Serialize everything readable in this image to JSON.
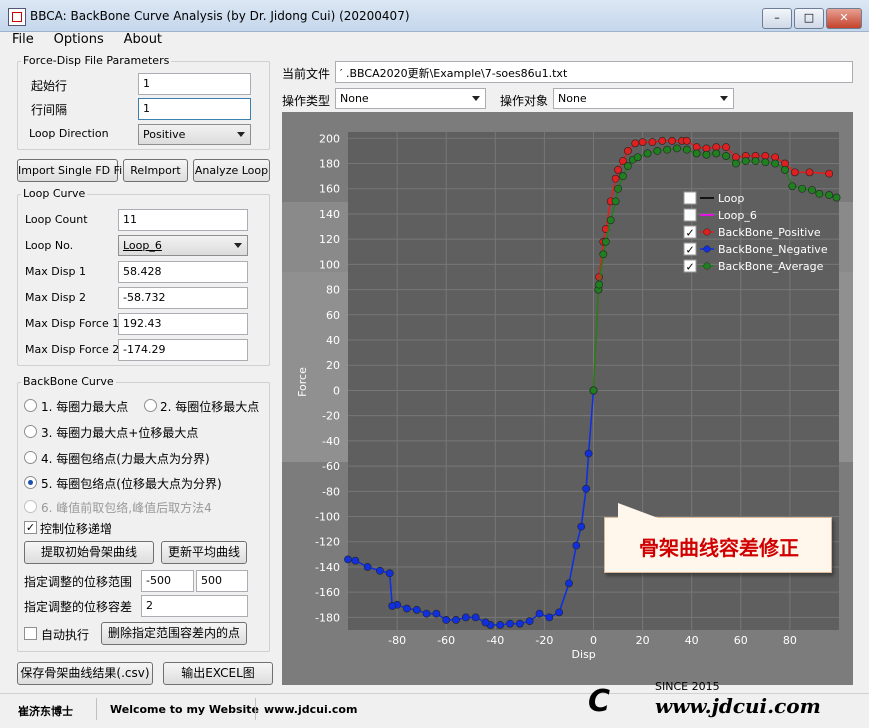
{
  "window": {
    "title": "BBCA: BackBone Curve Analysis (by Dr. Jidong Cui) (20200407)",
    "min": "–",
    "max": "□",
    "close": "✕"
  },
  "menu": [
    "File",
    "Options",
    "About"
  ],
  "fd_params": {
    "title": "Force-Disp File Parameters",
    "start_row_label": "起始行",
    "start_row": "1",
    "row_interval_label": "行间隔",
    "row_interval": "1",
    "loop_dir_label": "Loop Direction",
    "loop_dir": "Positive"
  },
  "buttons": {
    "import": "Import Single FD File",
    "reimport": "ReImport",
    "analyze": "Analyze Loop",
    "extract": "提取初始骨架曲线",
    "update": "更新平均曲线",
    "delete": "删除指定范围容差内的点",
    "save": "保存骨架曲线结果(.csv)",
    "excel": "输出EXCEL图"
  },
  "loop_curve": {
    "title": "Loop Curve",
    "count_label": "Loop Count",
    "count": "11",
    "no_label": "Loop No.",
    "no": "Loop_6",
    "max1_label": "Max Disp 1",
    "max1": "58.428",
    "max2_label": "Max Disp 2",
    "max2": "-58.732",
    "f1_label": "Max Disp Force 1",
    "f1": "192.43",
    "f2_label": "Max Disp Force 2",
    "f2": "-174.29"
  },
  "backbone": {
    "title": "BackBone Curve",
    "opt1": "1. 每圈力最大点",
    "opt2": "2. 每圈位移最大点",
    "opt3": "3. 每圈力最大点+位移最大点",
    "opt4": "4. 每圈包络点(力最大点为分界)",
    "opt5": "5. 每圈包络点(位移最大点为分界)",
    "opt6": "6. 峰值前取包络,峰值后取方法4",
    "ctrl": "控制位移递增",
    "range_label": "指定调整的位移范围",
    "range_min": "-500",
    "range_max": "500",
    "tol_label": "指定调整的位移容差",
    "tol": "2",
    "auto": "自动执行"
  },
  "file": {
    "label": "当前文件",
    "path": "′                                       .BBCA2020更新\\Example\\7-soes86u1.txt",
    "op_type_label": "操作类型",
    "op_type": "None",
    "op_target_label": "操作对象",
    "op_target": "None"
  },
  "status": {
    "author": "崔济东博士",
    "welcome": "Welcome to my Website",
    "site": "www.jdcui.com",
    "since": "SINCE 2015",
    "logo_text": "www.jdcui.com"
  },
  "callout": "骨架曲线容差修正",
  "chart_data": {
    "type": "line",
    "xlabel": "Disp",
    "ylabel": "Force",
    "xlim": [
      -100,
      100
    ],
    "ylim": [
      -190,
      205
    ],
    "xticks": [
      -80,
      -60,
      -40,
      -20,
      0,
      20,
      40,
      60,
      80
    ],
    "yticks": [
      200,
      180,
      160,
      140,
      120,
      100,
      80,
      60,
      40,
      20,
      0,
      -20,
      -40,
      -60,
      -80,
      -100,
      -120,
      -140,
      -160,
      -180
    ],
    "legend_position": "top-right",
    "series": [
      {
        "name": "Loop",
        "color": "#000000",
        "checked": false,
        "points": []
      },
      {
        "name": "Loop_6",
        "color": "#ff00ff",
        "checked": false,
        "points": []
      },
      {
        "name": "BackBone_Positive",
        "color": "#e02020",
        "checked": true,
        "points": [
          [
            0,
            0
          ],
          [
            2,
            80
          ],
          [
            2.3,
            90
          ],
          [
            4,
            118
          ],
          [
            5,
            128
          ],
          [
            7,
            150
          ],
          [
            9,
            168
          ],
          [
            10,
            175
          ],
          [
            12,
            182
          ],
          [
            14,
            190
          ],
          [
            17,
            196
          ],
          [
            20,
            197
          ],
          [
            24,
            197
          ],
          [
            28,
            198
          ],
          [
            32,
            198
          ],
          [
            36,
            198
          ],
          [
            38,
            198
          ],
          [
            42,
            193
          ],
          [
            46,
            192
          ],
          [
            50,
            193
          ],
          [
            54,
            193
          ],
          [
            58,
            185
          ],
          [
            62,
            186
          ],
          [
            66,
            186
          ],
          [
            70,
            186
          ],
          [
            74,
            185
          ],
          [
            78,
            180
          ],
          [
            82,
            173
          ],
          [
            88,
            173
          ],
          [
            96,
            172
          ]
        ]
      },
      {
        "name": "BackBone_Negative",
        "color": "#1030e0",
        "checked": true,
        "points": [
          [
            0,
            0
          ],
          [
            -2,
            -50
          ],
          [
            -3,
            -78
          ],
          [
            -5,
            -108
          ],
          [
            -7,
            -123
          ],
          [
            -10,
            -153
          ],
          [
            -14,
            -176
          ],
          [
            -18,
            -180
          ],
          [
            -22,
            -177
          ],
          [
            -26,
            -183
          ],
          [
            -30,
            -185
          ],
          [
            -34,
            -185
          ],
          [
            -38,
            -186
          ],
          [
            -42,
            -186
          ],
          [
            -44,
            -184
          ],
          [
            -48,
            -180
          ],
          [
            -52,
            -180
          ],
          [
            -56,
            -182
          ],
          [
            -60,
            -182
          ],
          [
            -64,
            -177
          ],
          [
            -68,
            -177
          ],
          [
            -72,
            -174
          ],
          [
            -76,
            -173
          ],
          [
            -80,
            -170
          ],
          [
            -82,
            -171
          ],
          [
            -83,
            -145
          ],
          [
            -87,
            -143
          ],
          [
            -92,
            -140
          ],
          [
            -97,
            -135
          ],
          [
            -100,
            -134
          ]
        ]
      },
      {
        "name": "BackBone_Average",
        "color": "#208020",
        "checked": true,
        "points": [
          [
            0,
            0
          ],
          [
            2,
            80
          ],
          [
            2.3,
            84
          ],
          [
            4,
            108
          ],
          [
            5,
            118
          ],
          [
            7,
            135
          ],
          [
            9,
            150
          ],
          [
            10,
            160
          ],
          [
            12,
            170
          ],
          [
            14,
            178
          ],
          [
            16,
            183
          ],
          [
            18,
            185
          ],
          [
            22,
            188
          ],
          [
            26,
            190
          ],
          [
            30,
            191
          ],
          [
            34,
            192
          ],
          [
            38,
            191
          ],
          [
            42,
            188
          ],
          [
            46,
            187
          ],
          [
            50,
            188
          ],
          [
            54,
            186
          ],
          [
            58,
            180
          ],
          [
            62,
            182
          ],
          [
            66,
            182
          ],
          [
            70,
            181
          ],
          [
            74,
            180
          ],
          [
            78,
            175
          ],
          [
            81,
            162
          ],
          [
            85,
            160
          ],
          [
            89,
            159
          ],
          [
            92,
            156
          ],
          [
            96,
            155
          ],
          [
            99,
            153
          ]
        ]
      }
    ]
  }
}
